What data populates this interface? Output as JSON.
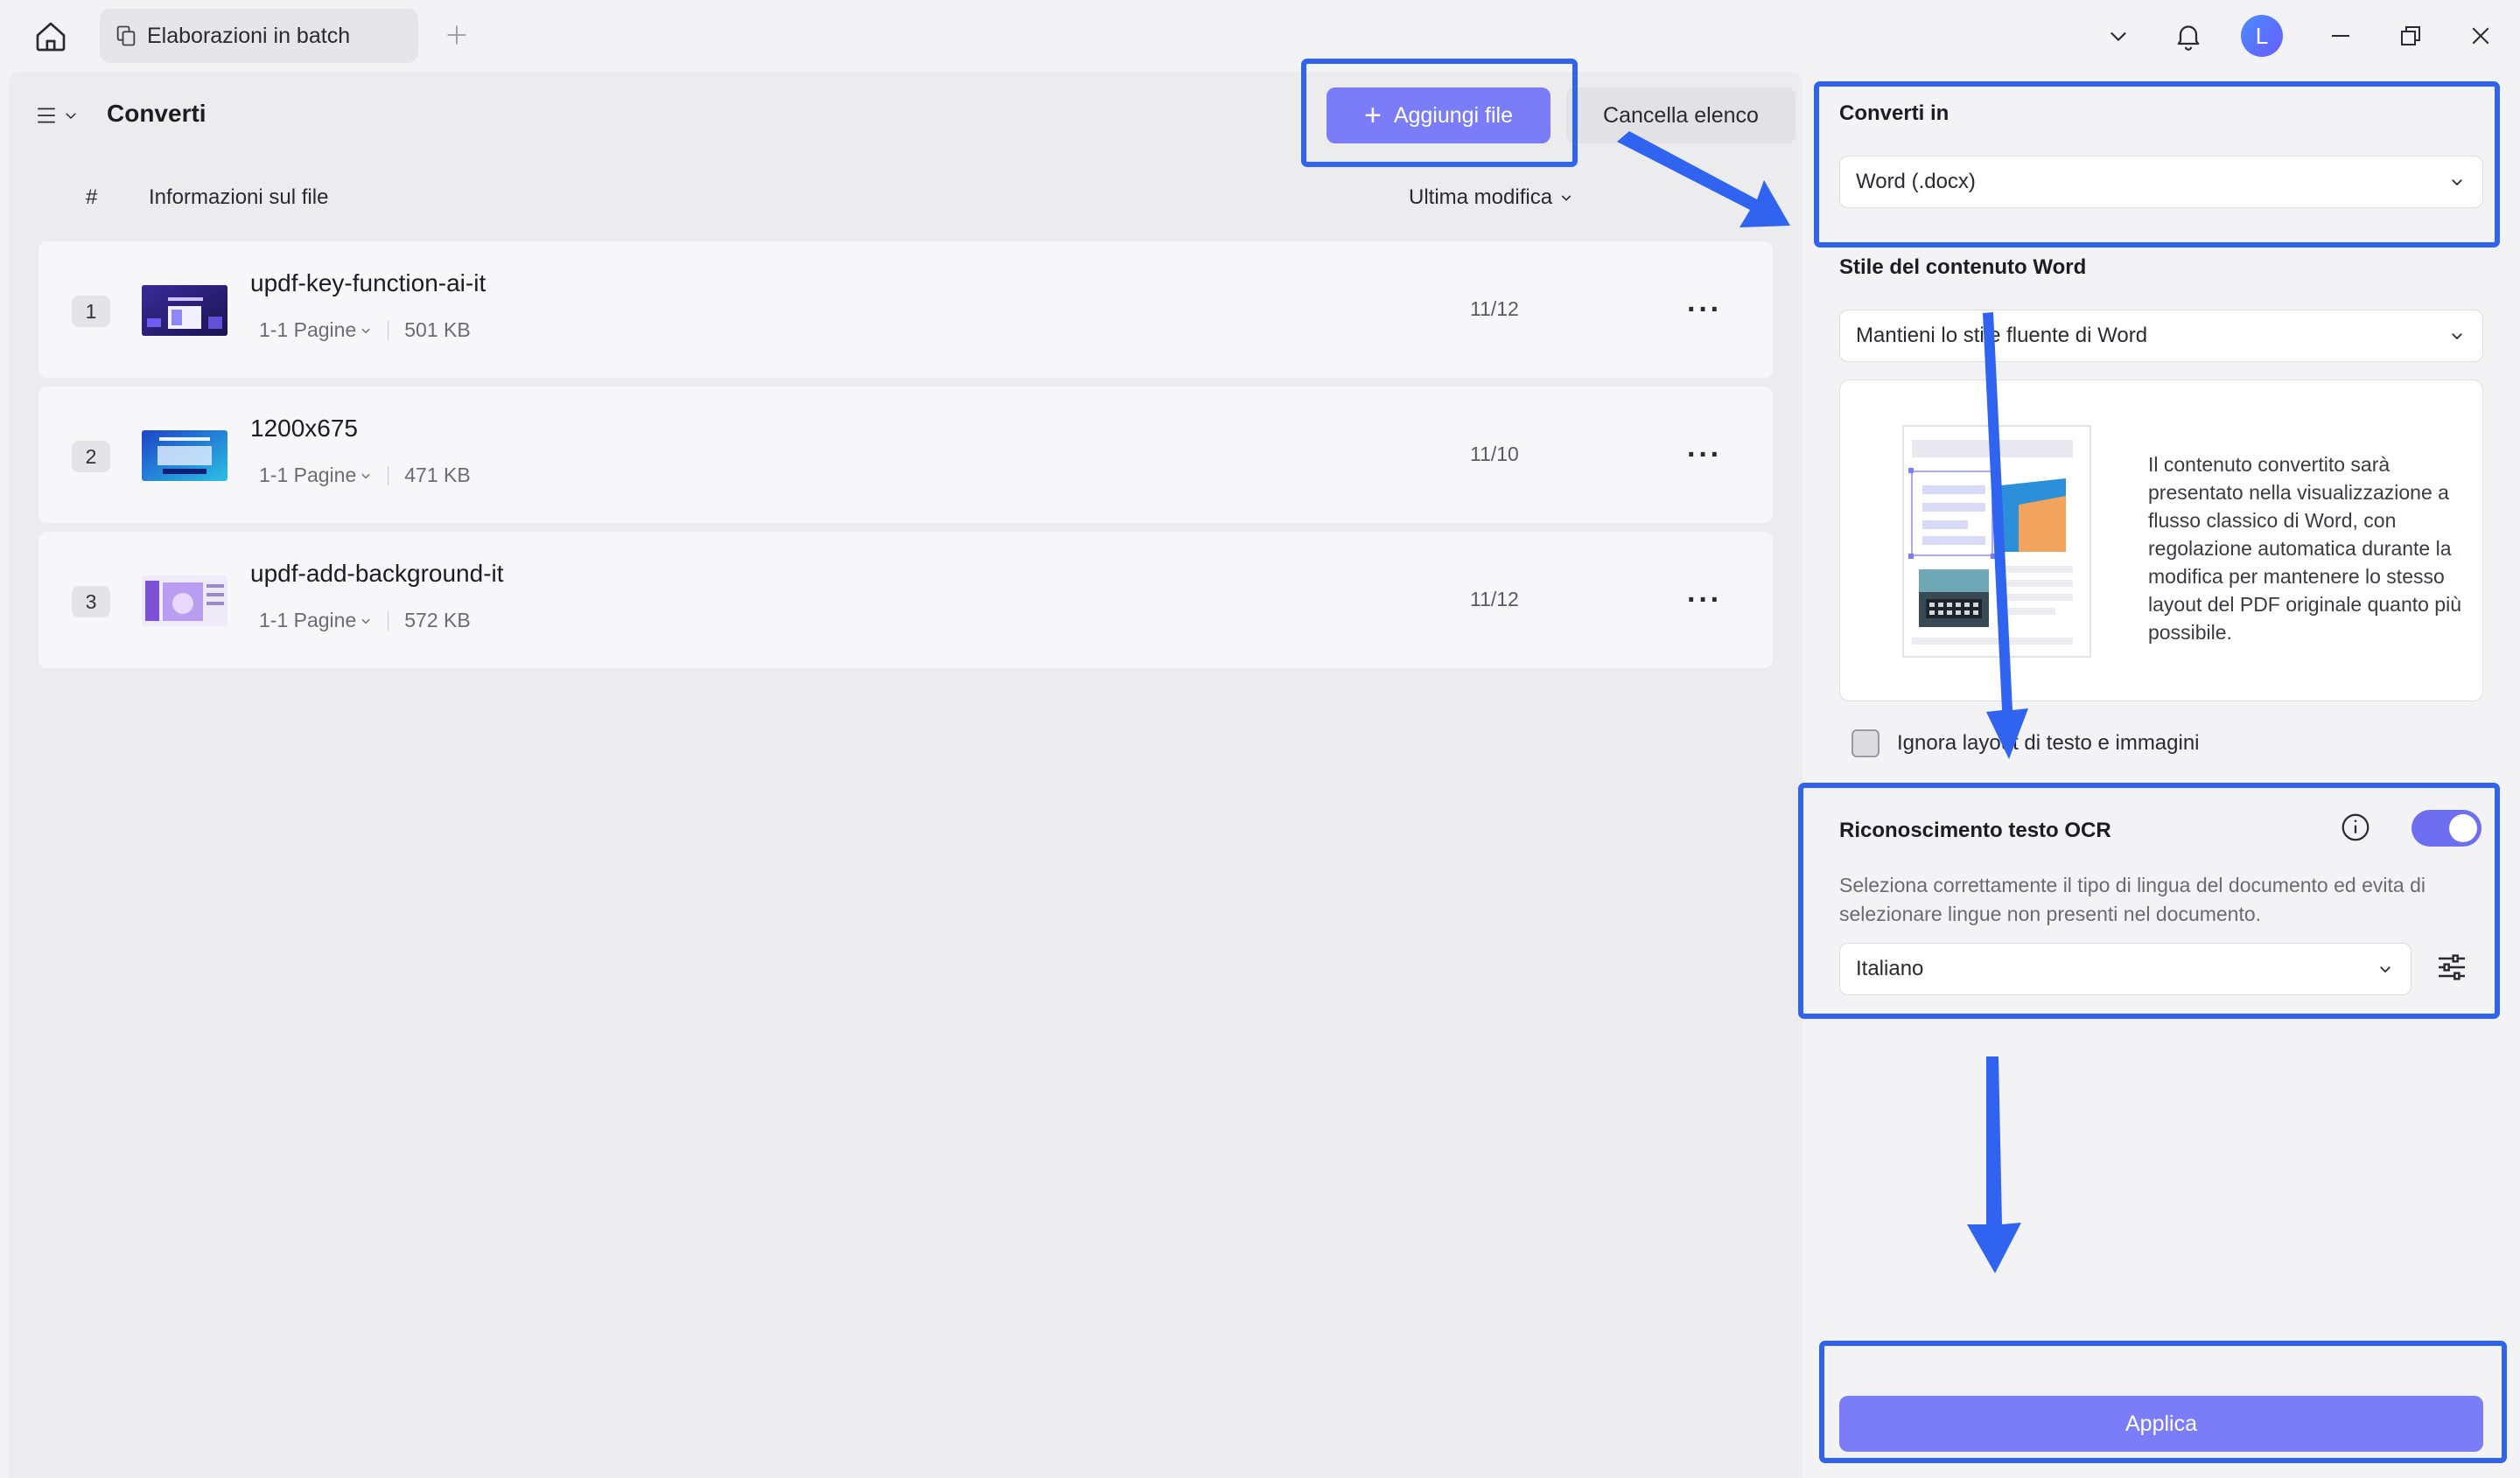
{
  "titlebar": {
    "tab_label": "Elaborazioni in batch",
    "avatar_initial": "L",
    "icons": [
      "home-icon",
      "batch-icon",
      "plus-icon",
      "chevron-down-icon",
      "bell-icon",
      "minimize-icon",
      "restore-icon",
      "close-icon"
    ]
  },
  "left": {
    "title": "Converti",
    "add_button": "Aggiungi file",
    "clear_button": "Cancella elenco",
    "columns": {
      "index": "#",
      "info": "Informazioni sul file",
      "modified": "Ultima modifica"
    },
    "files": [
      {
        "index": "1",
        "name": "updf-key-function-ai-it",
        "pages": "1-1 Pagine",
        "size": "501 KB",
        "date": "11/12"
      },
      {
        "index": "2",
        "name": "1200x675",
        "pages": "1-1 Pagine",
        "size": "471 KB",
        "date": "11/10"
      },
      {
        "index": "3",
        "name": "updf-add-background-it",
        "pages": "1-1 Pagine",
        "size": "572 KB",
        "date": "11/12"
      }
    ],
    "more_label": "···"
  },
  "right": {
    "convert_to_label": "Converti in",
    "convert_to_value": "Word (.docx)",
    "style_label": "Stile del contenuto Word",
    "style_value": "Mantieni lo stile fluente di Word",
    "style_description": "Il contenuto convertito sarà presentato nella visualizzazione a flusso classico di Word, con regolazione automatica durante la modifica per mantenere lo stesso layout del PDF originale quanto più possibile.",
    "ignore_layout_label": "Ignora layout di testo e immagini",
    "ocr_title": "Riconoscimento testo OCR",
    "ocr_enabled": true,
    "ocr_description": "Seleziona correttamente il tipo di lingua del documento ed evita di selezionare lingue non presenti nel documento.",
    "ocr_language": "Italiano",
    "apply_button": "Applica"
  },
  "colors": {
    "accent": "#7b7cf7",
    "annotation_blue": "#2f63f0"
  }
}
